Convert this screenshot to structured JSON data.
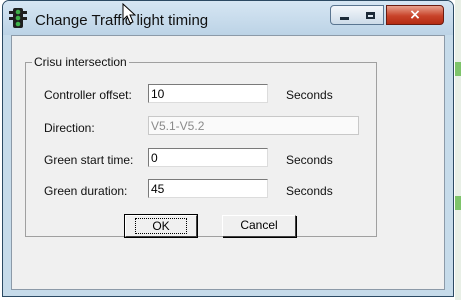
{
  "window": {
    "title": "Change Traffic light timing",
    "icon": "traffic-light-icon",
    "controls": {
      "minimize": "minimize-icon",
      "maximize": "maximize-icon",
      "close": "×"
    }
  },
  "group": {
    "label": "Crisu intersection",
    "fields": [
      {
        "label": "Controller offset:",
        "value": "10",
        "unit": "Seconds",
        "editable": true
      },
      {
        "label": "Direction:",
        "value": "V5.1-V5.2",
        "unit": "",
        "editable": false
      },
      {
        "label": "Green start time:",
        "value": "0",
        "unit": "Seconds",
        "editable": true
      },
      {
        "label": "Green duration:",
        "value": "45",
        "unit": "Seconds",
        "editable": true
      }
    ]
  },
  "buttons": {
    "ok": "OK",
    "cancel": "Cancel"
  },
  "colors": {
    "title_bar": "#c6dbea",
    "close_button": "#c8432a",
    "dialog_face": "#f0f0f0"
  }
}
